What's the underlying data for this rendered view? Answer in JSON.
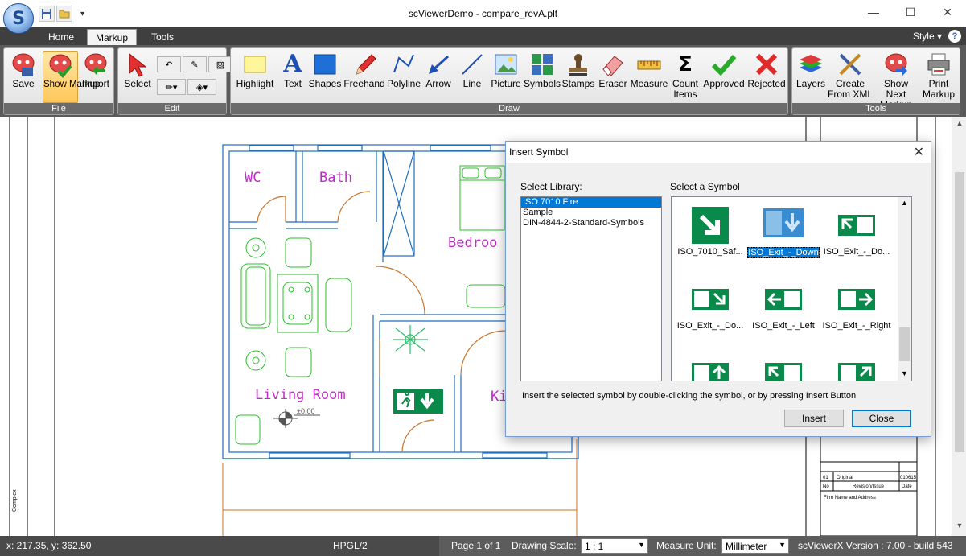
{
  "window": {
    "title": "scViewerDemo - compare_revA.plt",
    "minimize": "—",
    "maximize": "☐",
    "close": "✕"
  },
  "quick_access": {
    "save_icon": "floppy-icon",
    "open_icon": "folder-icon",
    "dropdown": "▾"
  },
  "tabs": [
    {
      "label": "Home"
    },
    {
      "label": "Markup",
      "active": true
    },
    {
      "label": "Tools"
    }
  ],
  "style_menu": "Style ▾",
  "help": "?",
  "ribbon": {
    "groups": {
      "file": "File",
      "edit": "Edit",
      "draw": "Draw",
      "tools": "Tools"
    },
    "file_buttons": [
      {
        "label": "Save",
        "icon": "save-markup-icon"
      },
      {
        "label": "Show Markup",
        "icon": "show-markup-icon",
        "active": true
      },
      {
        "label": "Import",
        "icon": "import-markup-icon"
      }
    ],
    "edit_select": "Select",
    "draw_buttons": [
      {
        "label": "Highlight"
      },
      {
        "label": "Text"
      },
      {
        "label": "Shapes"
      },
      {
        "label": "Freehand"
      },
      {
        "label": "Polyline"
      },
      {
        "label": "Arrow"
      },
      {
        "label": "Line"
      },
      {
        "label": "Picture"
      },
      {
        "label": "Symbols"
      },
      {
        "label": "Stamps"
      },
      {
        "label": "Eraser"
      },
      {
        "label": "Measure"
      },
      {
        "label": "Count Items"
      },
      {
        "label": "Approved"
      },
      {
        "label": "Rejected"
      }
    ],
    "tools_buttons": [
      {
        "label": "Layers"
      },
      {
        "label": "Create From XML"
      },
      {
        "label": "Show Next Markup"
      },
      {
        "label": "Print Markup"
      }
    ],
    "text_glyph": "A",
    "count_glyph": "Σ"
  },
  "drawing": {
    "rooms": {
      "wc": "WC",
      "bath": "Bath",
      "bedroom": "Bedroo",
      "living": "Living Room",
      "kitchen": "Ki"
    },
    "level_mark": "±0.00",
    "title_block": {
      "row1_num": "01",
      "row1_text": "Original",
      "row1_date": "010615",
      "row2_num": "No",
      "row2_text": "Revision/Issue",
      "row2_date": "Date",
      "row3_text": "Firm Name and Address"
    },
    "side_text": "Complex"
  },
  "dialog": {
    "title": "Insert Symbol",
    "close": "✕",
    "library_label": "Select Library:",
    "symbol_label": "Select a Symbol",
    "libraries": [
      {
        "name": "ISO 7010 Fire",
        "selected": true
      },
      {
        "name": "Sample"
      },
      {
        "name": "DIN-4844-2-Standard-Symbols"
      }
    ],
    "symbols": [
      {
        "caption": "ISO_7010_Saf..."
      },
      {
        "caption": "ISO_Exit_-_Down",
        "selected": true
      },
      {
        "caption": "ISO_Exit_-_Do..."
      },
      {
        "caption": "ISO_Exit_-_Do..."
      },
      {
        "caption": "ISO_Exit_-_Left"
      },
      {
        "caption": "ISO_Exit_-_Right"
      }
    ],
    "hint": "Insert the selected symbol by double-clicking the symbol, or by pressing Insert Button",
    "insert": "Insert",
    "close_btn": "Close",
    "sign_green": "#0a8a4a"
  },
  "status": {
    "coords": "x: 217.35, y: 362.50",
    "format": "HPGL/2",
    "page": "Page 1 of 1",
    "scale_label": "Drawing Scale:",
    "scale_value": "1 : 1",
    "unit_label": "Measure Unit:",
    "unit_value": "Millimeter",
    "version": "scViewerX Version : 7.00 - build 543"
  }
}
